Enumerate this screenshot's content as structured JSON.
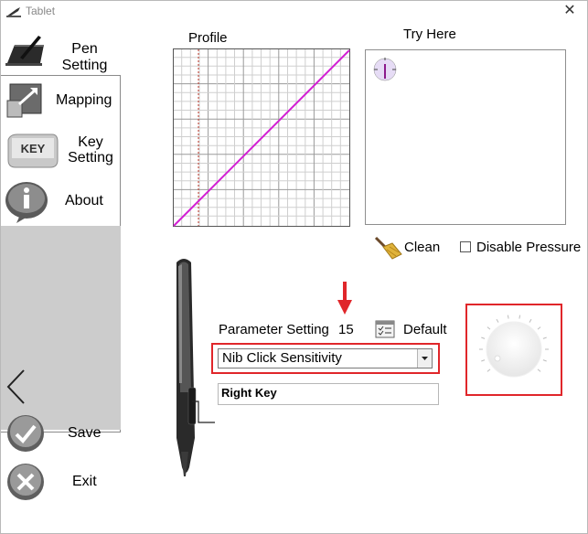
{
  "window": {
    "title": "Tablet",
    "close_glyph": "✕"
  },
  "sidebar": {
    "items": [
      {
        "label": "Pen Setting",
        "icon": "tablet-pen-icon"
      },
      {
        "label": "Mapping",
        "icon": "mapping-icon"
      },
      {
        "label": "Key\nSetting",
        "icon": "key-icon",
        "icon_text": "KEY"
      },
      {
        "label": "About",
        "icon": "info-icon"
      }
    ],
    "back_glyph": "<",
    "save_label": "Save",
    "exit_label": "Exit"
  },
  "profile": {
    "label": "Profile"
  },
  "try_here": {
    "label": "Try Here"
  },
  "clean_label": "Clean",
  "disable_pressure": {
    "label": "Disable Pressure",
    "checked": false
  },
  "parameter": {
    "label": "Parameter Setting",
    "value": "15"
  },
  "default_label": "Default",
  "sensitivity_select": {
    "selected": "Nib Click Sensitivity"
  },
  "right_key": {
    "label": "Right Key"
  },
  "colors": {
    "accent_line": "#d21fd3",
    "highlight_red": "#e0262a",
    "sidebar_gray": "#cccccc"
  }
}
